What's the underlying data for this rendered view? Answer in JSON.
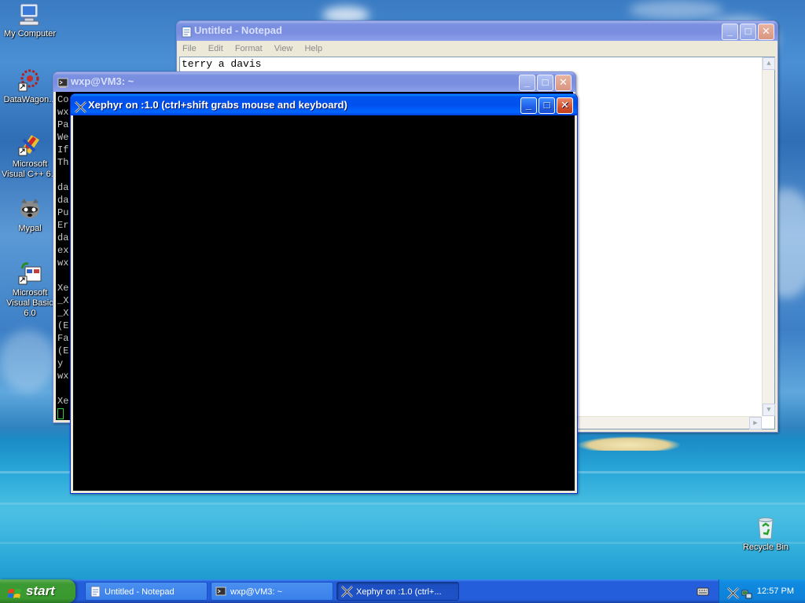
{
  "desktop_icons": [
    {
      "label": "My Computer",
      "icon": "my-computer-icon"
    },
    {
      "label": "DataWagon...",
      "icon": "datawagon-icon"
    },
    {
      "label": "Microsoft Visual C++ 6.0",
      "icon": "msvc-icon"
    },
    {
      "label": "Mypal",
      "icon": "mypal-icon"
    },
    {
      "label": "Microsoft Visual Basic 6.0",
      "icon": "msvb-icon"
    },
    {
      "label": "Recycle Bin",
      "icon": "recycle-bin-icon"
    }
  ],
  "notepad": {
    "title": "Untitled - Notepad",
    "menu": [
      "File",
      "Edit",
      "Format",
      "View",
      "Help"
    ],
    "text": "terry a davis"
  },
  "terminal": {
    "title": "wxp@VM3: ~",
    "lines": [
      "Co",
      "wx",
      "Pa",
      "We",
      "If",
      "Th",
      "",
      "da",
      "da",
      "Pu",
      "Er",
      "da",
      "ex",
      "wx",
      "",
      "Xe",
      "_X",
      "_X",
      "(E",
      "Fa",
      "(E",
      "y",
      "wx",
      "",
      "Xe"
    ]
  },
  "xephyr": {
    "title": "Xephyr on :1.0 (ctrl+shift grabs mouse and keyboard)"
  },
  "taskbar": {
    "start_label": "start",
    "tasks": [
      {
        "label": "Untitled - Notepad"
      },
      {
        "label": "wxp@VM3: ~"
      },
      {
        "label": "Xephyr on :1.0 (ctrl+..."
      }
    ],
    "clock": "12:57 PM"
  },
  "colors": {
    "titlebar_active": "#0054e3",
    "taskbar": "#245edb",
    "start_button": "#3c9a32",
    "close_button": "#d5502a"
  }
}
